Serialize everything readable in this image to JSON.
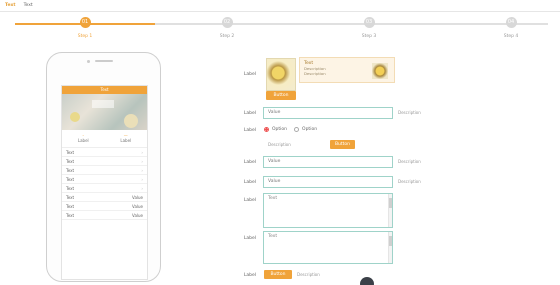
{
  "topbar": {
    "brand": "Text",
    "section": "Text"
  },
  "steps": [
    {
      "num": "01",
      "label": "Step 1",
      "active": true
    },
    {
      "num": "02",
      "label": "Step 2",
      "active": false
    },
    {
      "num": "03",
      "label": "Step 3",
      "active": false
    },
    {
      "num": "04",
      "label": "Step 4",
      "active": false
    }
  ],
  "phone": {
    "header": "Text",
    "tabs": [
      {
        "value": "-",
        "label": "Label"
      },
      {
        "value": "—",
        "label": "Label"
      }
    ],
    "items": [
      {
        "label": "Text",
        "value": ""
      },
      {
        "label": "Text",
        "value": ""
      },
      {
        "label": "Text",
        "value": ""
      },
      {
        "label": "Text",
        "value": ""
      },
      {
        "label": "Text",
        "value": ""
      },
      {
        "label": "Text",
        "value": "Value"
      },
      {
        "label": "Text",
        "value": "Value"
      },
      {
        "label": "Text",
        "value": "Value"
      }
    ]
  },
  "form": {
    "logo_label": "Label",
    "upload_btn": "Button",
    "tip_title": "Text",
    "tip_line1": "Description",
    "tip_line2": "Description",
    "name_label": "Label",
    "name_value": "Value",
    "name_hint": "Description",
    "type_label": "Label",
    "type_opt1": "Option",
    "type_opt2": "Option",
    "type_note": "Description",
    "type_btn": "Button",
    "contact_label": "Label",
    "contact_value": "Value",
    "contact_hint": "Description",
    "phone_label": "Label",
    "phone_value": "Value",
    "phone_hint": "Description",
    "intro_label": "Label",
    "intro_text": "Text",
    "desc_label": "Label",
    "desc_text": "Text",
    "submit_label": "Label",
    "submit_btn": "Button",
    "submit_hint": "Description"
  }
}
